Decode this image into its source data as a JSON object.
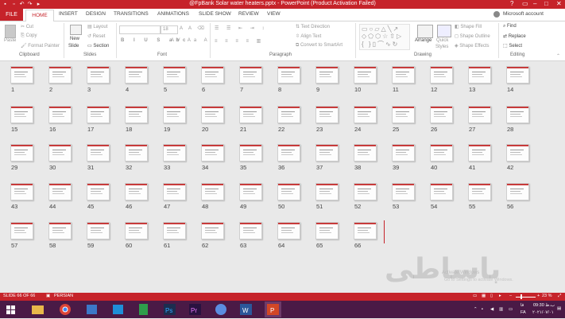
{
  "title_bar": {
    "title": "@FpBank Solar water heaters.pptx - PowerPoint (Product Activation Failed)"
  },
  "tabs": [
    "FILE",
    "HOME",
    "INSERT",
    "DESIGN",
    "TRANSITIONS",
    "ANIMATIONS",
    "SLIDE SHOW",
    "REVIEW",
    "VIEW"
  ],
  "account": "Microsoft account",
  "ribbon": {
    "clipboard": {
      "paste": "Paste",
      "cut": "Cut",
      "copy": "Copy",
      "format_painter": "Format Painter",
      "label": "Clipboard"
    },
    "slides": {
      "new_slide": "New",
      "new_slide2": "Slide",
      "layout": "Layout",
      "reset": "Reset",
      "section": "Section",
      "label": "Slides"
    },
    "font": {
      "label": "Font",
      "font_size": "18"
    },
    "paragraph": {
      "text_direction": "Text Direction",
      "align_text": "Align Text",
      "convert_smartart": "Convert to SmartArt",
      "label": "Paragraph"
    },
    "drawing": {
      "arrange": "Arrange",
      "quick_styles": "Quick",
      "quick_styles2": "Styles",
      "shape_fill": "Shape Fill",
      "shape_outline": "Shape Outline",
      "shape_effects": "Shape Effects",
      "label": "Drawing"
    },
    "editing": {
      "find": "Find",
      "replace": "Replace",
      "select": "Select",
      "label": "Editing"
    }
  },
  "slides": [
    "1",
    "2",
    "3",
    "4",
    "5",
    "6",
    "7",
    "8",
    "9",
    "10",
    "11",
    "12",
    "13",
    "14",
    "15",
    "16",
    "17",
    "18",
    "19",
    "20",
    "21",
    "22",
    "23",
    "24",
    "25",
    "26",
    "27",
    "28",
    "29",
    "30",
    "31",
    "32",
    "33",
    "34",
    "35",
    "36",
    "37",
    "38",
    "39",
    "40",
    "41",
    "42",
    "43",
    "44",
    "45",
    "46",
    "47",
    "48",
    "49",
    "50",
    "51",
    "52",
    "53",
    "54",
    "55",
    "56",
    "57",
    "58",
    "59",
    "60",
    "61",
    "62",
    "63",
    "64",
    "65",
    "66"
  ],
  "status": {
    "slide_info": "SLIDE 66 OF 66",
    "language": "PERSIAN",
    "zoom": "23 %"
  },
  "watermark": {
    "logo_text": "باساطی",
    "activate_title": "Activate Windows",
    "activate_sub": "Go to Settings to activate Windows."
  },
  "taskbar": {
    "lang": "FA",
    "time": "09:30 ب.ظ",
    "date": "۲۰۲۱/۰۷/۰۱",
    "lang_ind": "فا"
  },
  "colors": {
    "accent": "#c6232a",
    "taskbar": "#4a1a46"
  }
}
